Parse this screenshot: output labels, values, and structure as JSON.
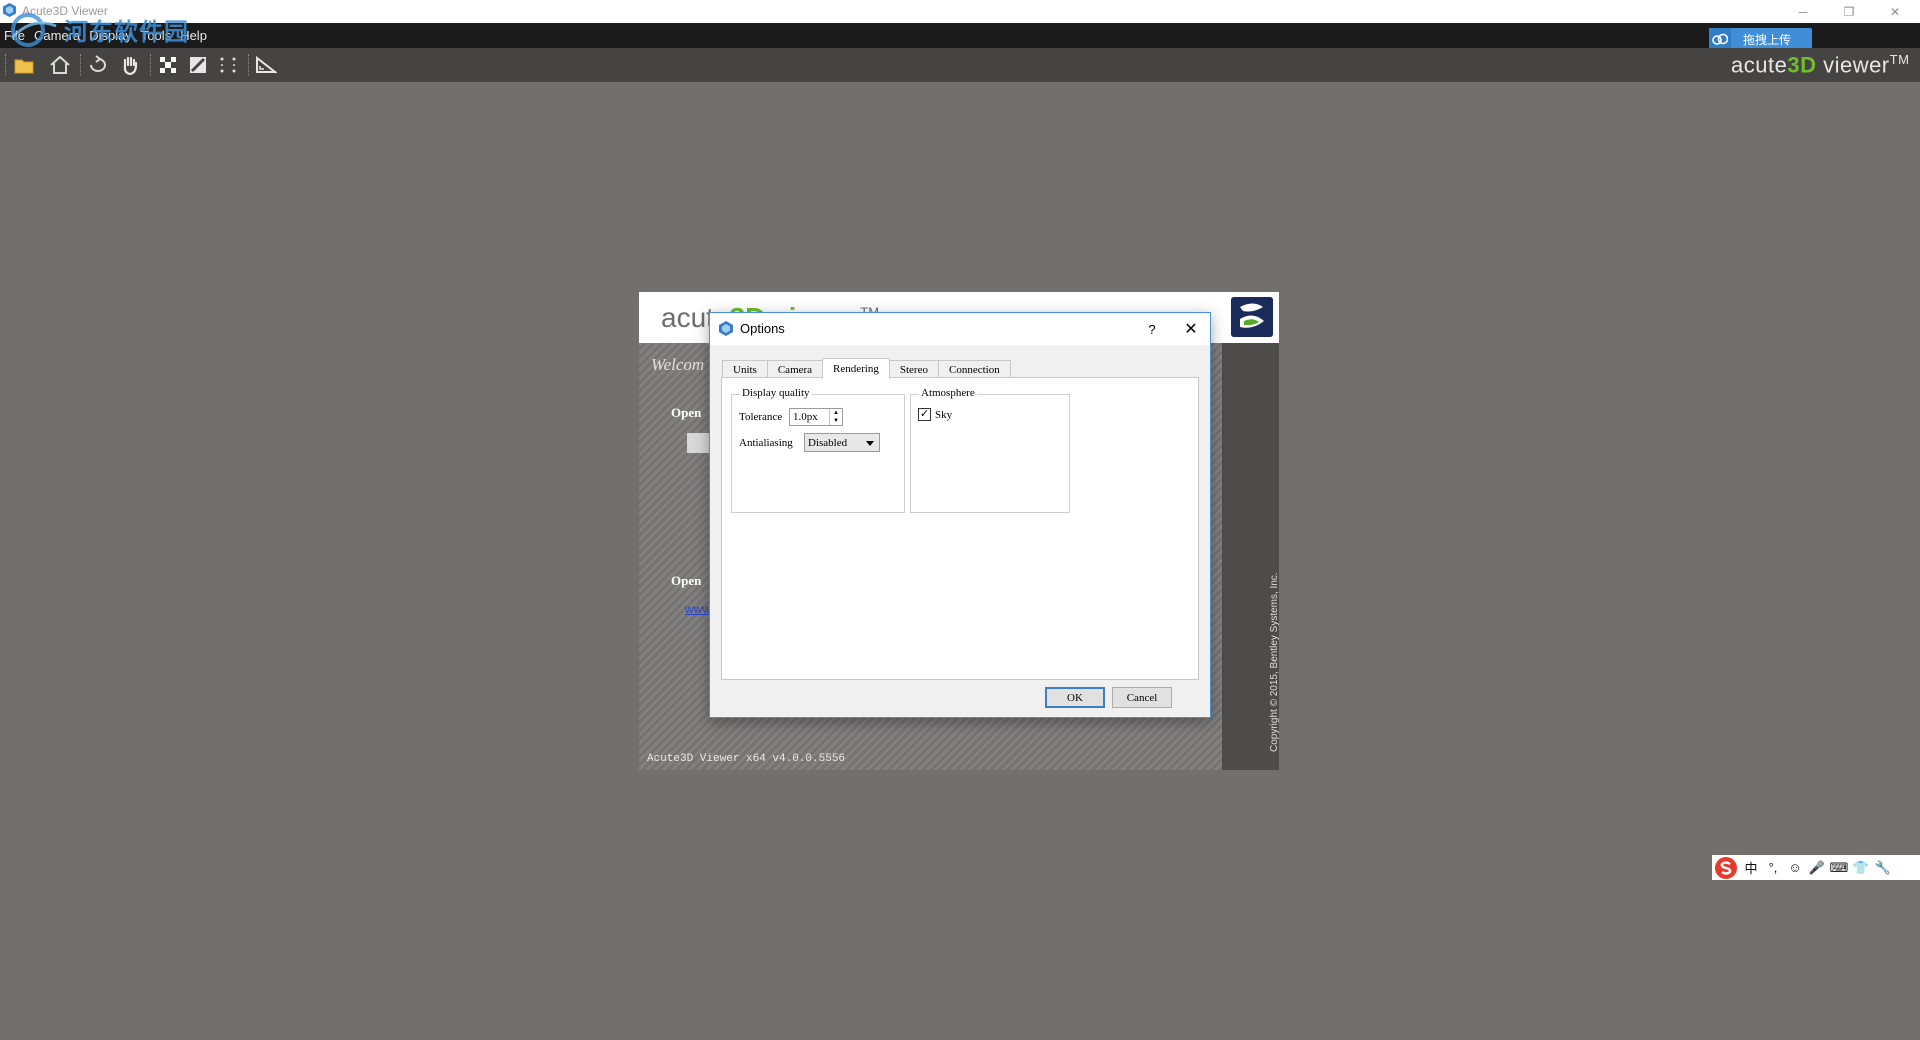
{
  "window": {
    "title": "Acute3D Viewer",
    "controls": {
      "minimize": "─",
      "maximize": "❐",
      "close": "✕"
    }
  },
  "menubar": {
    "items": [
      "File",
      "Camera",
      "Display",
      "Tools",
      "Help"
    ]
  },
  "watermark_text": "河东软件园",
  "upload_button": {
    "label": "拖拽上传"
  },
  "toolbar": {
    "icons": [
      "open-folder-icon",
      "home-icon",
      "rotate-icon",
      "pan-hand-icon",
      "checker-icon",
      "grid-icon",
      "points-icon",
      "measure-icon"
    ]
  },
  "brand": {
    "prefix": "acute",
    "accent": "3D",
    "suffix": " viewer",
    "tm": "TM",
    "accent_color": "#6fbf2a"
  },
  "splash": {
    "logo_prefix": "acute",
    "logo_accent": "3D viewer",
    "logo_tm": "TM",
    "welcome": "Welcom",
    "open_label_1": "Open",
    "open_label_2": "Open",
    "link_text": "www.",
    "version": "Acute3D Viewer x64 v4.0.0.5556",
    "copyright": "Copyright © 2015, Bentley Systems, Inc."
  },
  "dialog": {
    "title": "Options",
    "help": "?",
    "close": "✕",
    "tabs": [
      {
        "label": "Units",
        "active": false
      },
      {
        "label": "Camera",
        "active": false
      },
      {
        "label": "Rendering",
        "active": true
      },
      {
        "label": "Stereo",
        "active": false
      },
      {
        "label": "Connection",
        "active": false
      }
    ],
    "display_quality": {
      "legend": "Display quality",
      "tolerance_label": "Tolerance",
      "tolerance_value": "1.0px",
      "antialiasing_label": "Antialiasing",
      "antialiasing_value": "Disabled"
    },
    "atmosphere": {
      "legend": "Atmosphere",
      "sky_label": "Sky",
      "sky_checked": true
    },
    "ok_label": "OK",
    "cancel_label": "Cancel"
  },
  "tray": {
    "items": [
      "中",
      "°,",
      "☺",
      "🎤",
      "⌨",
      "👕",
      "🔧"
    ]
  }
}
